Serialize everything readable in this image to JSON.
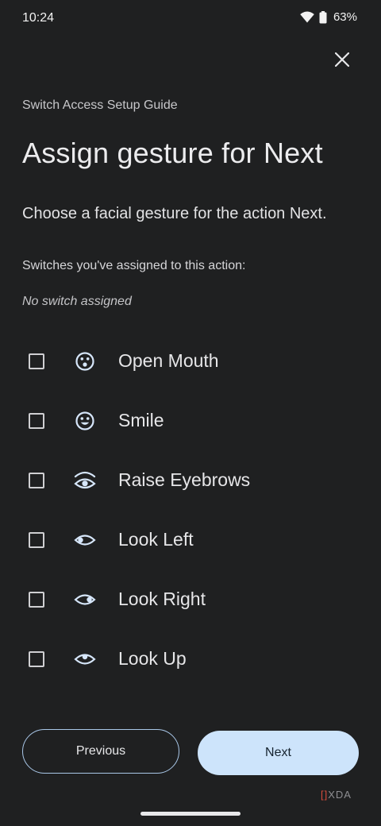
{
  "status_bar": {
    "time": "10:24",
    "battery_percent": "63%",
    "icons": [
      "wifi-icon",
      "battery-icon"
    ]
  },
  "header": {
    "close_icon": "close-icon",
    "subheading": "Switch Access Setup Guide",
    "title": "Assign gesture for Next",
    "description": "Choose a facial gesture for the action Next."
  },
  "assigned": {
    "label": "Switches you've assigned to this action:",
    "value": "No switch assigned"
  },
  "gestures": [
    {
      "label": "Open Mouth",
      "icon": "open-mouth-face-icon",
      "checked": false
    },
    {
      "label": "Smile",
      "icon": "smile-face-icon",
      "checked": false
    },
    {
      "label": "Raise Eyebrows",
      "icon": "raise-eyebrows-eye-icon",
      "checked": false
    },
    {
      "label": "Look Left",
      "icon": "look-left-eye-icon",
      "checked": false
    },
    {
      "label": "Look Right",
      "icon": "look-right-eye-icon",
      "checked": false
    },
    {
      "label": "Look Up",
      "icon": "look-up-eye-icon",
      "checked": false
    }
  ],
  "footer": {
    "previous_label": "Previous",
    "next_label": "Next"
  },
  "watermark": {
    "text": "XDA"
  },
  "colors": {
    "background": "#1f2021",
    "accent": "#cde4fb",
    "outline": "#a9c7e8",
    "icon": "#d6e6fa"
  }
}
